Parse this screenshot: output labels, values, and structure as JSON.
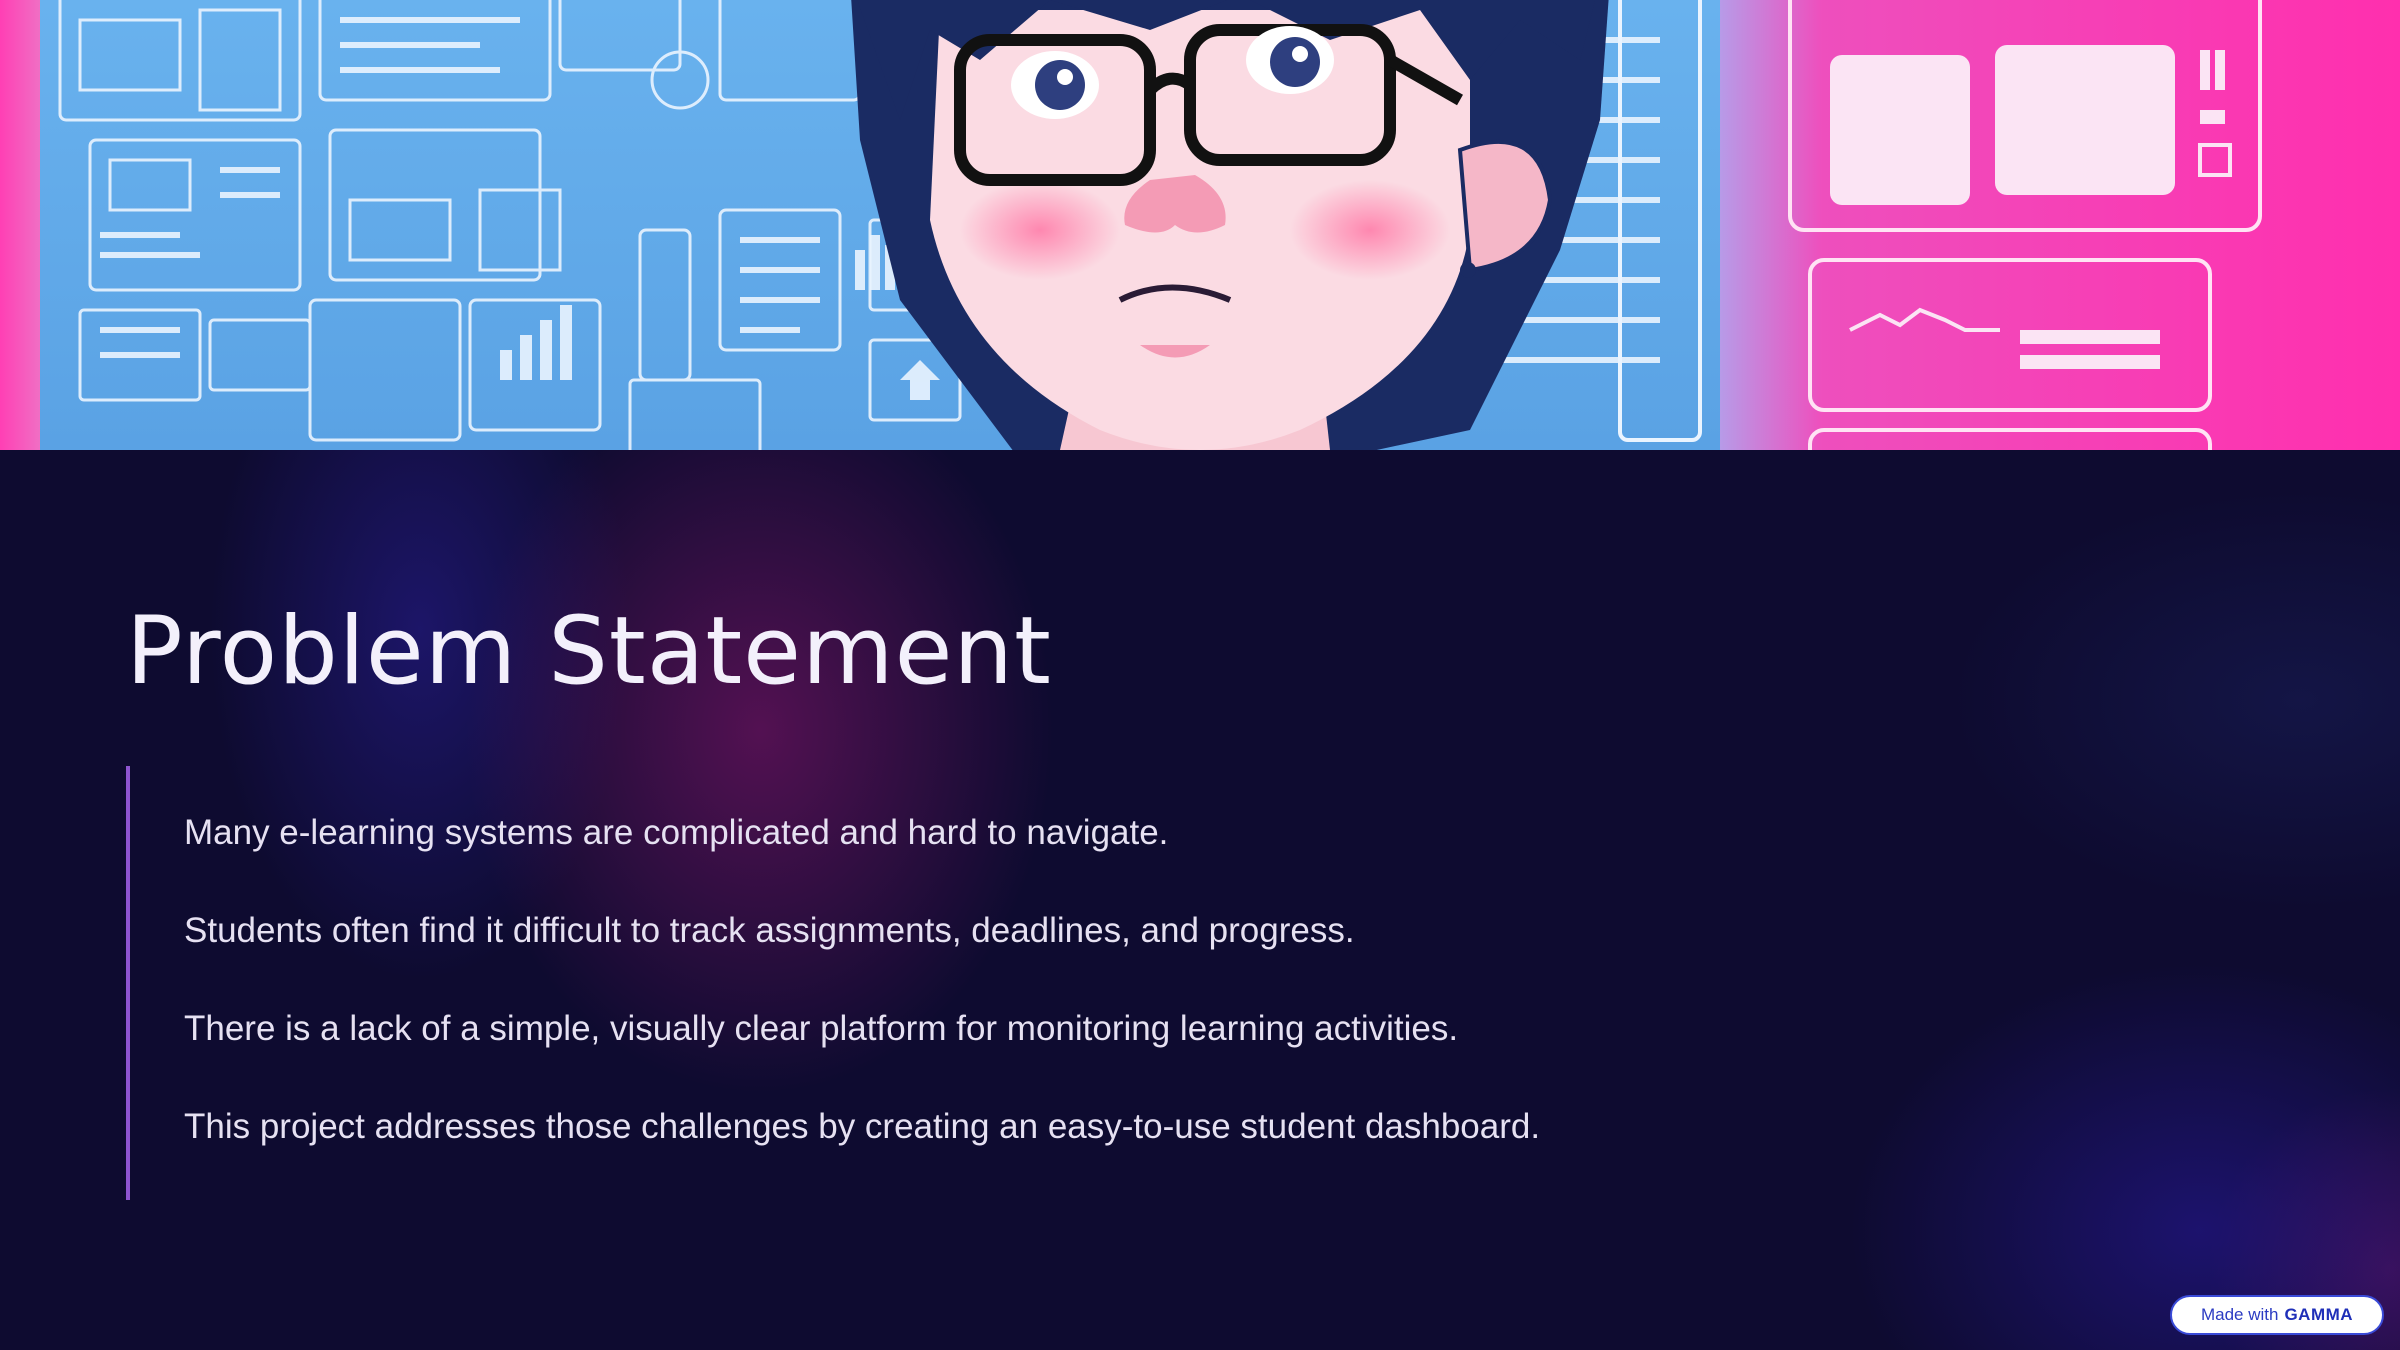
{
  "slide": {
    "title": "Problem Statement",
    "points": [
      "Many e-learning systems are complicated and hard to navigate.",
      "Students often find it difficult to track assignments, deadlines, and progress.",
      "There is a lack of a simple, visually clear platform for monitoring learning activities.",
      "This project addresses those challenges by creating an easy-to-use student dashboard."
    ]
  },
  "badge": {
    "prefix": "Made with",
    "brand": "GAMMA"
  },
  "colors": {
    "background": "#0e0b30",
    "accent_bar": "#8e55d0",
    "hero_blue": "#5fa9ea",
    "hero_pink": "#ff3fb4",
    "badge_text": "#2b3bc2"
  },
  "hero": {
    "illustration": "anime-student-with-glasses-in-front-of-ui-wireframes"
  }
}
